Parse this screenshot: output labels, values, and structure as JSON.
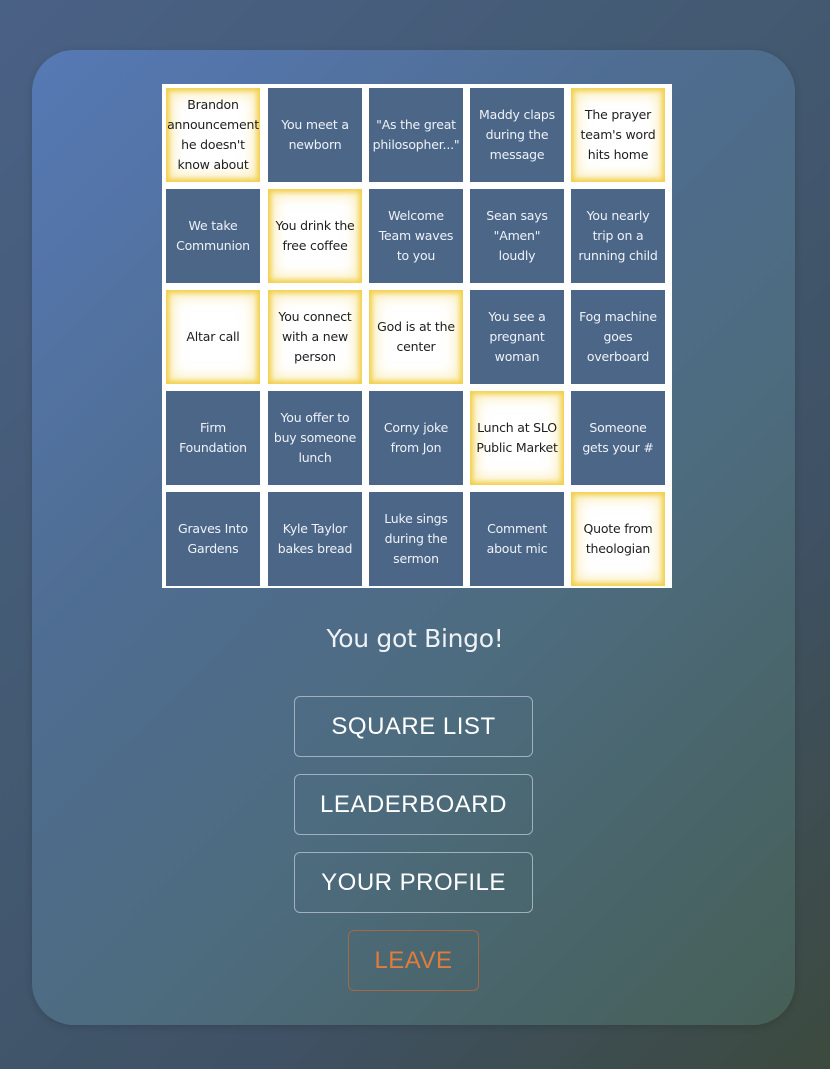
{
  "board": {
    "cells": [
      [
        {
          "text": "Brandon announcement he doesn't know about",
          "marked": true
        },
        {
          "text": "You meet a newborn",
          "marked": false
        },
        {
          "text": "\"As the great philosopher...\"",
          "marked": false
        },
        {
          "text": "Maddy claps during the message",
          "marked": false
        },
        {
          "text": "The prayer team's word hits home",
          "marked": true
        }
      ],
      [
        {
          "text": "We take Communion",
          "marked": false
        },
        {
          "text": "You drink the free coffee",
          "marked": true
        },
        {
          "text": "Welcome Team waves to you",
          "marked": false
        },
        {
          "text": "Sean says \"Amen\" loudly",
          "marked": false
        },
        {
          "text": "You nearly trip on a running child",
          "marked": false
        }
      ],
      [
        {
          "text": "Altar call",
          "marked": true
        },
        {
          "text": "You connect with a new person",
          "marked": true
        },
        {
          "text": "God is at the center",
          "marked": true
        },
        {
          "text": "You see a pregnant woman",
          "marked": false
        },
        {
          "text": "Fog machine goes overboard",
          "marked": false
        }
      ],
      [
        {
          "text": "Firm Foundation",
          "marked": false
        },
        {
          "text": "You offer to buy someone lunch",
          "marked": false
        },
        {
          "text": "Corny joke from Jon",
          "marked": false
        },
        {
          "text": "Lunch at SLO Public Market",
          "marked": true
        },
        {
          "text": "Someone gets your #",
          "marked": false
        }
      ],
      [
        {
          "text": "Graves Into Gardens",
          "marked": false
        },
        {
          "text": "Kyle Taylor bakes bread",
          "marked": false
        },
        {
          "text": "Luke sings during the sermon",
          "marked": false
        },
        {
          "text": "Comment about mic",
          "marked": false
        },
        {
          "text": "Quote from theologian",
          "marked": true
        }
      ]
    ]
  },
  "status": {
    "message": "You got Bingo!"
  },
  "buttons": {
    "square_list": "SQUARE LIST",
    "leaderboard": "LEADERBOARD",
    "your_profile": "YOUR PROFILE",
    "leave": "LEAVE"
  },
  "colors": {
    "cell_unmarked": "#4c6688",
    "cell_marked": "#ffffff",
    "marked_glow": "#f2d04e",
    "leave_accent": "#e07c3c"
  }
}
